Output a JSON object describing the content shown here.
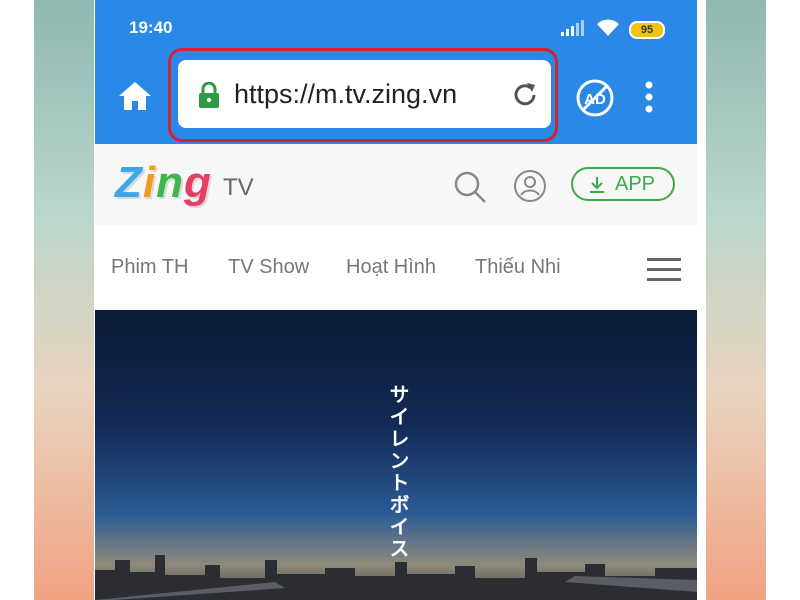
{
  "status_bar": {
    "time": "19:40",
    "battery": "95",
    "icons": [
      "signal-icon",
      "wifi-icon",
      "battery-icon"
    ]
  },
  "browser": {
    "url": "https://m.tv.zing.vn",
    "icons": [
      "home-icon",
      "lock-icon",
      "reload-icon",
      "ad-block-icon",
      "more-vert-icon"
    ],
    "colors": {
      "toolbar": "#2a89e6",
      "highlight": "#d6222f",
      "lock": "#2e9a44"
    }
  },
  "site": {
    "logo_letters": [
      "Z",
      "i",
      "n",
      "g"
    ],
    "logo_colors": [
      "#3aa8e8",
      "#f39a1e",
      "#3cb54a",
      "#e83e63"
    ],
    "logo_suffix": "TV",
    "app_button": "APP",
    "nav": [
      "Phim TH",
      "TV Show",
      "Hoạt Hình",
      "Thiếu Nhi"
    ],
    "icons": [
      "search-icon",
      "user-icon",
      "download-icon",
      "hamburger-menu-icon"
    ]
  },
  "video": {
    "title_text": "サイレントボイス"
  }
}
